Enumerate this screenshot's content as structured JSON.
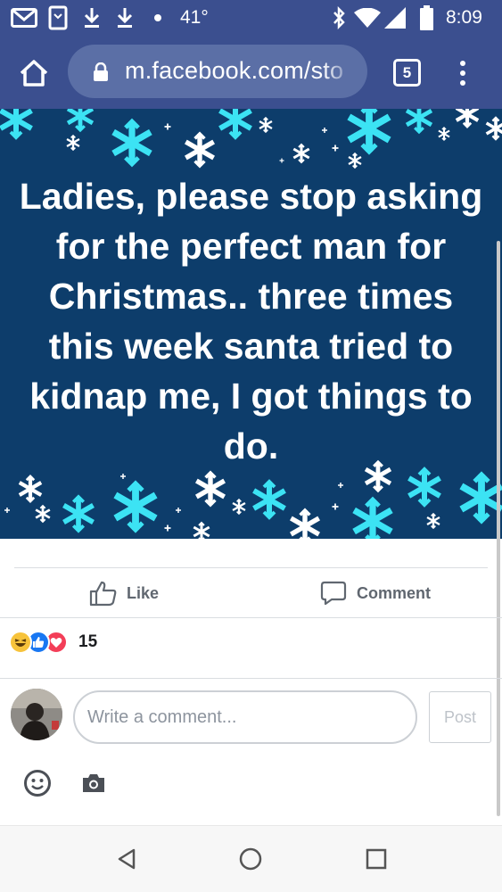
{
  "status_bar": {
    "temperature": "41°",
    "time": "8:09",
    "icons": [
      "gmail-icon",
      "screenshot-icon",
      "download-icon",
      "download-icon",
      "dot-icon",
      "bluetooth-icon",
      "wifi-icon",
      "signal-icon",
      "battery-icon"
    ]
  },
  "toolbar": {
    "url": "m.facebook.com/sto",
    "tab_count": "5"
  },
  "post": {
    "image_text": "Ladies, please stop asking for the perfect man for Christmas.. three times this week santa tried to kidnap me, I got things to do.",
    "colors": {
      "background": "#0d3d6b",
      "flake_cyan": "#3ce3f4",
      "flake_white": "#ffffff"
    }
  },
  "actions": {
    "like_label": "Like",
    "comment_label": "Comment"
  },
  "reactions": {
    "types": [
      "haha",
      "like",
      "love"
    ],
    "count": "15"
  },
  "composer": {
    "placeholder": "Write a comment...",
    "post_label": "Post"
  },
  "nav": {
    "buttons": [
      "back-icon",
      "home-icon",
      "recents-icon"
    ]
  }
}
